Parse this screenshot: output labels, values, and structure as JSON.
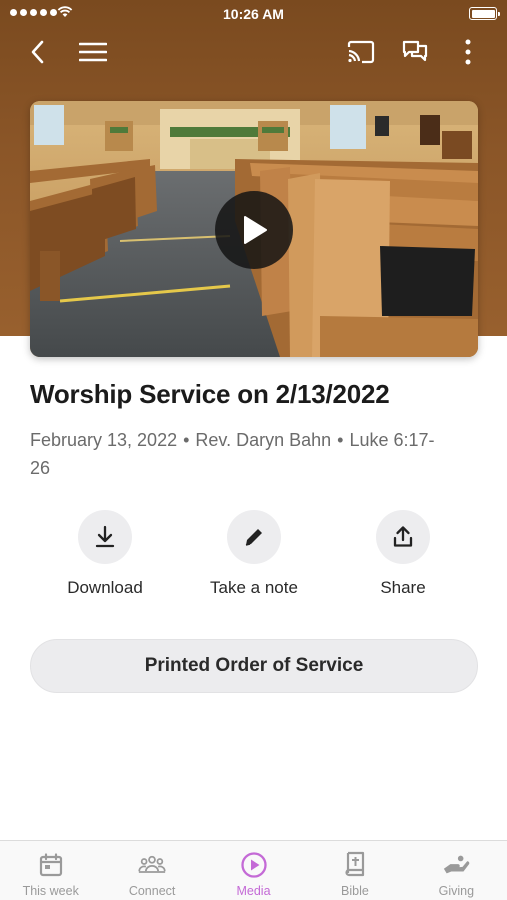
{
  "status_bar": {
    "time": "10:26 AM"
  },
  "nav": {
    "icons": {
      "back": "chevron-left-icon",
      "menu": "hamburger-menu-icon",
      "cast": "cast-icon",
      "chat": "chat-bubbles-icon",
      "more": "more-vertical-icon"
    }
  },
  "video": {
    "play_icon": "play-icon",
    "thumbnail_subject": "church sanctuary with wooden pews"
  },
  "sermon": {
    "title": "Worship Service on 2/13/2022",
    "date": "February 13, 2022",
    "speaker": "Rev. Daryn Bahn",
    "reference": "Luke 6:17-26",
    "separator": "•"
  },
  "actions": [
    {
      "label": "Download",
      "icon": "download-icon"
    },
    {
      "label": "Take a note",
      "icon": "pencil-icon"
    },
    {
      "label": "Share",
      "icon": "share-icon"
    }
  ],
  "order_button": {
    "label": "Printed Order of Service"
  },
  "tabs": [
    {
      "label": "This week",
      "icon": "calendar-icon",
      "active": false
    },
    {
      "label": "Connect",
      "icon": "people-icon",
      "active": false
    },
    {
      "label": "Media",
      "icon": "play-circle-icon",
      "active": true
    },
    {
      "label": "Bible",
      "icon": "bible-icon",
      "active": false
    },
    {
      "label": "Giving",
      "icon": "giving-hand-icon",
      "active": false
    }
  ],
  "colors": {
    "header_brown": "#8b5628",
    "active_tab": "#c46ad6",
    "inactive_tab": "#9a9a9a"
  }
}
